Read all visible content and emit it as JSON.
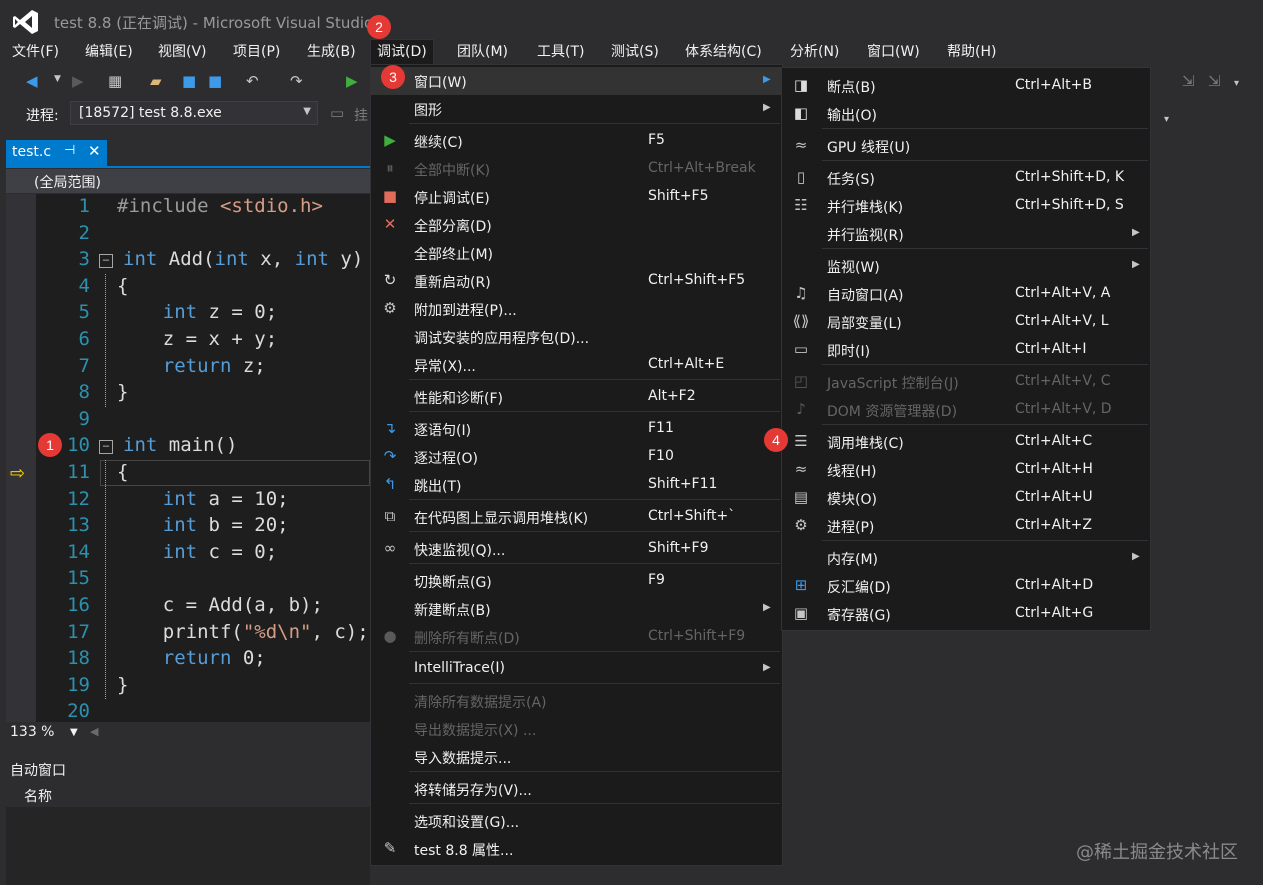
{
  "window": {
    "title": "test 8.8 (正在调试) - Microsoft Visual Studio"
  },
  "menubar": [
    {
      "label": "文件(F)"
    },
    {
      "label": "编辑(E)"
    },
    {
      "label": "视图(V)"
    },
    {
      "label": "项目(P)"
    },
    {
      "label": "生成(B)"
    },
    {
      "label": "调试(D)"
    },
    {
      "label": "团队(M)"
    },
    {
      "label": "工具(T)"
    },
    {
      "label": "测试(S)"
    },
    {
      "label": "体系结构(C)"
    },
    {
      "label": "分析(N)"
    },
    {
      "label": "窗口(W)"
    },
    {
      "label": "帮助(H)"
    }
  ],
  "toolbar": {
    "process_label": "进程:",
    "process_value": "[18572] test 8.8.exe",
    "extra_label": "挂"
  },
  "editor": {
    "tab_name": "test.c",
    "scope": "(全局范围)",
    "zoom": "133 %",
    "lines": [
      {
        "n": "1",
        "text": "#include <stdio.h>"
      },
      {
        "n": "2",
        "text": ""
      },
      {
        "n": "3",
        "text": "int Add(int x, int y)"
      },
      {
        "n": "4",
        "text": "{"
      },
      {
        "n": "5",
        "text": "    int z = 0;"
      },
      {
        "n": "6",
        "text": "    z = x + y;"
      },
      {
        "n": "7",
        "text": "    return z;"
      },
      {
        "n": "8",
        "text": "}"
      },
      {
        "n": "9",
        "text": ""
      },
      {
        "n": "10",
        "text": "int main()"
      },
      {
        "n": "11",
        "text": "{"
      },
      {
        "n": "12",
        "text": "    int a = 10;"
      },
      {
        "n": "13",
        "text": "    int b = 20;"
      },
      {
        "n": "14",
        "text": "    int c = 0;"
      },
      {
        "n": "15",
        "text": ""
      },
      {
        "n": "16",
        "text": "    c = Add(a, b);"
      },
      {
        "n": "17",
        "text": "    printf(\"%d\\n\", c);"
      },
      {
        "n": "18",
        "text": "    return 0;"
      },
      {
        "n": "19",
        "text": "}"
      },
      {
        "n": "20",
        "text": ""
      }
    ]
  },
  "auto_window": {
    "title": "自动窗口",
    "col_name": "名称"
  },
  "debug_menu": [
    {
      "label": "窗口(W)",
      "shortcut": "",
      "sub": true,
      "icon": ""
    },
    {
      "label": "图形",
      "shortcut": "",
      "sub": true,
      "icon": ""
    },
    {
      "label": "继续(C)",
      "shortcut": "F5",
      "icon": "play-icon"
    },
    {
      "label": "全部中断(K)",
      "shortcut": "Ctrl+Alt+Break",
      "disabled": true,
      "icon": "pause-icon"
    },
    {
      "label": "停止调试(E)",
      "shortcut": "Shift+F5",
      "icon": "stop-icon"
    },
    {
      "label": "全部分离(D)",
      "shortcut": "",
      "icon": "x-icon"
    },
    {
      "label": "全部终止(M)",
      "shortcut": "",
      "icon": ""
    },
    {
      "label": "重新启动(R)",
      "shortcut": "Ctrl+Shift+F5",
      "icon": "restart-icon"
    },
    {
      "label": "附加到进程(P)...",
      "shortcut": "",
      "icon": "gears-icon"
    },
    {
      "label": "调试安装的应用程序包(D)...",
      "shortcut": "",
      "icon": ""
    },
    {
      "label": "异常(X)...",
      "shortcut": "Ctrl+Alt+E",
      "icon": ""
    },
    {
      "label": "性能和诊断(F)",
      "shortcut": "Alt+F2",
      "icon": ""
    },
    {
      "label": "逐语句(I)",
      "shortcut": "F11",
      "icon": "step-into-icon"
    },
    {
      "label": "逐过程(O)",
      "shortcut": "F10",
      "icon": "step-over-icon"
    },
    {
      "label": "跳出(T)",
      "shortcut": "Shift+F11",
      "icon": "step-out-icon"
    },
    {
      "label": "在代码图上显示调用堆栈(K)",
      "shortcut": "Ctrl+Shift+`",
      "icon": "code-map-icon"
    },
    {
      "label": "快速监视(Q)...",
      "shortcut": "Shift+F9",
      "icon": "glasses-icon"
    },
    {
      "label": "切换断点(G)",
      "shortcut": "F9",
      "icon": ""
    },
    {
      "label": "新建断点(B)",
      "shortcut": "",
      "sub": true,
      "icon": ""
    },
    {
      "label": "删除所有断点(D)",
      "shortcut": "Ctrl+Shift+F9",
      "disabled": true,
      "icon": "delete-breakpoints-icon"
    },
    {
      "label": "IntelliTrace(I)",
      "shortcut": "",
      "sub": true,
      "icon": ""
    },
    {
      "label": "清除所有数据提示(A)",
      "shortcut": "",
      "disabled": true,
      "icon": ""
    },
    {
      "label": "导出数据提示(X) ...",
      "shortcut": "",
      "disabled": true,
      "icon": ""
    },
    {
      "label": "导入数据提示...",
      "shortcut": "",
      "icon": ""
    },
    {
      "label": "将转储另存为(V)...",
      "shortcut": "",
      "icon": ""
    },
    {
      "label": "选项和设置(G)...",
      "shortcut": "",
      "icon": ""
    },
    {
      "label": "test 8.8 属性...",
      "shortcut": "",
      "icon": "wrench-icon"
    }
  ],
  "window_menu": [
    {
      "label": "断点(B)",
      "shortcut": "Ctrl+Alt+B",
      "icon": "breakpoints-icon"
    },
    {
      "label": "输出(O)",
      "shortcut": "",
      "icon": "output-icon"
    },
    {
      "label": "GPU 线程(U)",
      "shortcut": "",
      "icon": "gpu-threads-icon"
    },
    {
      "label": "任务(S)",
      "shortcut": "Ctrl+Shift+D, K",
      "icon": "tasks-icon"
    },
    {
      "label": "并行堆栈(K)",
      "shortcut": "Ctrl+Shift+D, S",
      "icon": "parallel-stacks-icon"
    },
    {
      "label": "并行监视(R)",
      "shortcut": "",
      "sub": true,
      "icon": ""
    },
    {
      "label": "监视(W)",
      "shortcut": "",
      "sub": true,
      "icon": ""
    },
    {
      "label": "自动窗口(A)",
      "shortcut": "Ctrl+Alt+V, A",
      "icon": "autos-icon"
    },
    {
      "label": "局部变量(L)",
      "shortcut": "Ctrl+Alt+V, L",
      "icon": "locals-icon"
    },
    {
      "label": "即时(I)",
      "shortcut": "Ctrl+Alt+I",
      "icon": "immediate-icon"
    },
    {
      "label": "JavaScript 控制台(J)",
      "shortcut": "Ctrl+Alt+V, C",
      "disabled": true,
      "icon": "js-console-icon"
    },
    {
      "label": "DOM 资源管理器(D)",
      "shortcut": "Ctrl+Alt+V, D",
      "disabled": true,
      "icon": "dom-explorer-icon"
    },
    {
      "label": "调用堆栈(C)",
      "shortcut": "Ctrl+Alt+C",
      "icon": "call-stack-icon"
    },
    {
      "label": "线程(H)",
      "shortcut": "Ctrl+Alt+H",
      "icon": "threads-icon"
    },
    {
      "label": "模块(O)",
      "shortcut": "Ctrl+Alt+U",
      "icon": "modules-icon"
    },
    {
      "label": "进程(P)",
      "shortcut": "Ctrl+Alt+Z",
      "icon": "processes-icon"
    },
    {
      "label": "内存(M)",
      "shortcut": "",
      "sub": true,
      "icon": ""
    },
    {
      "label": "反汇编(D)",
      "shortcut": "Ctrl+Alt+D",
      "icon": "disassembly-icon"
    },
    {
      "label": "寄存器(G)",
      "shortcut": "Ctrl+Alt+G",
      "icon": "registers-icon"
    }
  ],
  "badges": [
    "1",
    "2",
    "3",
    "4"
  ],
  "watermark": "@稀土掘金技术社区",
  "colors": {
    "accent": "#007acc",
    "menu_bg": "#1b1b1c",
    "badge": "#e53935"
  }
}
